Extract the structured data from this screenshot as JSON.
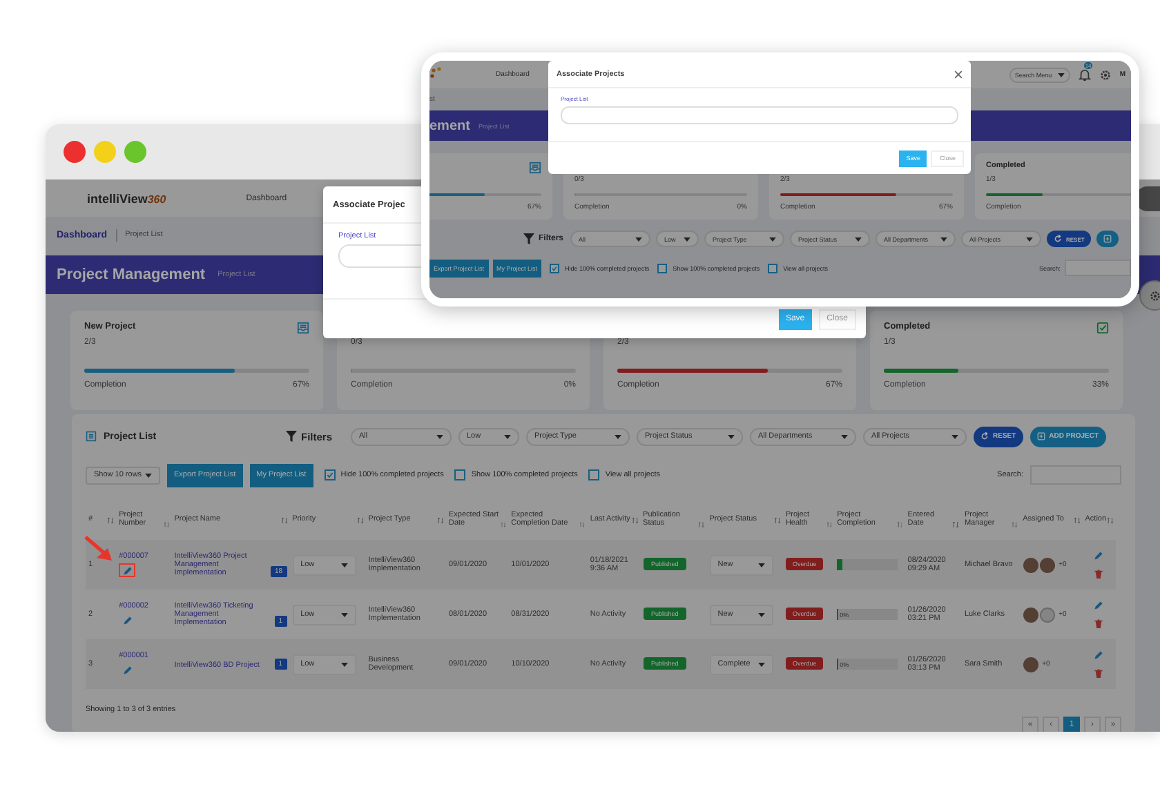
{
  "window_controls": [
    {
      "color": "#ec2f2f"
    },
    {
      "color": "#f3d11a"
    },
    {
      "color": "#69c52b"
    }
  ],
  "app": {
    "logo": {
      "text": "intelliView",
      "suffix": "360"
    },
    "nav": [
      "Dashboard"
    ],
    "breadcrumb": [
      "Dashboard",
      "Project List"
    ],
    "banner": {
      "title": "Project Management",
      "subtitle": "Project List"
    },
    "cards": [
      {
        "title": "New Project",
        "count": "2/3",
        "level": 0.67,
        "color": "#195f82",
        "label": "Completion",
        "percent": "67%"
      },
      {
        "count": "0/3",
        "level": 0,
        "label": "Completion",
        "percent": "0%"
      },
      {
        "count": "2/3",
        "level": 0.67,
        "color": "#821d1d",
        "label": "Completion",
        "percent": "67%"
      },
      {
        "title": "Completed",
        "count": "1/3",
        "level": 0.33,
        "color": "#14652c",
        "label": "Completion",
        "percent": "33%"
      }
    ],
    "list_title": "Project List",
    "filters": {
      "label": "Filters",
      "selects": [
        "All",
        "Low",
        "Project Type",
        "Project Status",
        "All Departments",
        "All Projects"
      ],
      "buttons": [
        {
          "kind": "reset",
          "label": "RESET"
        },
        {
          "kind": "add",
          "label": "ADD PROJECT"
        }
      ]
    },
    "rows_select": "Show 10 rows",
    "action_buttons": [
      "Export Project List",
      "My Project List"
    ],
    "checkboxes": [
      {
        "label": "Hide 100% completed projects",
        "checked": true
      },
      {
        "label": "Show 100% completed projects",
        "checked": false
      },
      {
        "label": "View all projects",
        "checked": false
      }
    ],
    "search_label": "Search:",
    "table": {
      "columns": [
        "#",
        "Project Number",
        "Project Name",
        "Priority",
        "Project Type",
        "Expected Start Date",
        "Expected Completion Date",
        "Last Activity",
        "Publication Status",
        "Project Status",
        "Project Health",
        "Project Completion",
        "Entered Date",
        "Project Manager",
        "Assigned To",
        "Action"
      ],
      "rows": [
        {
          "index": "1",
          "number": "#000007",
          "highlighted": true,
          "name": "IntelliView360 Project Management Implementation",
          "badge": "18",
          "priority": "Low",
          "type": "IntelliView360 Implementation",
          "start": "09/01/2020",
          "end": "10/01/2020",
          "last_activity": "01/18/2021 9:36 AM",
          "publication": "Published",
          "status": "New",
          "health": "Overdue",
          "level": 0.08,
          "entered": "08/24/2020 09:29 AM",
          "manager": "Michael Bravo",
          "avatars": [
            {
              "kind": "photo"
            },
            {
              "kind": "photo"
            }
          ],
          "more": "+0"
        },
        {
          "index": "2",
          "number": "#000002",
          "highlighted": false,
          "name": "IntelliView360 Ticketing Management Implementation",
          "badge": "1",
          "priority": "Low",
          "type": "IntelliView360 Implementation",
          "start": "08/01/2020",
          "end": "08/31/2020",
          "last_activity": "No Activity",
          "publication": "Published",
          "status": "New",
          "health": "Overdue",
          "level": 0,
          "completion_text": "0%",
          "entered": "01/26/2020 03:21 PM",
          "manager": "Luke Clarks",
          "avatars": [
            {
              "kind": "photo"
            },
            {
              "kind": "silhouette"
            }
          ],
          "more": "+0"
        },
        {
          "index": "3",
          "number": "#000001",
          "highlighted": false,
          "name": "IntelliView360 BD Project",
          "badge": "1",
          "priority": "Low",
          "type": "Business Development",
          "start": "09/01/2020",
          "end": "10/10/2020",
          "last_activity": "No Activity",
          "publication": "Published",
          "status": "Complete",
          "health": "Overdue",
          "level": 0,
          "completion_text": "0%",
          "entered": "01/26/2020 03:13 PM",
          "manager": "Sara Smith",
          "avatars": [
            {
              "kind": "photo"
            }
          ],
          "more": "+0"
        }
      ]
    },
    "footer": "Showing 1 to 3 of 3 entries",
    "pagination": [
      {
        "label": "«",
        "selected": false
      },
      {
        "label": "‹",
        "selected": false
      },
      {
        "label": "1",
        "selected": true
      },
      {
        "label": "›",
        "selected": false
      },
      {
        "label": "»",
        "selected": false
      }
    ]
  },
  "modal": {
    "title": "Associate Projec",
    "field_label": "Project List",
    "buttons": [
      {
        "kind": "primary",
        "label": "Save"
      },
      {
        "kind": "secondary",
        "label": "Close"
      }
    ]
  },
  "inset": {
    "nav": [
      "Dashboard"
    ],
    "search": "Search Menu",
    "badge": "14",
    "user": "M",
    "breadcrumb": "st",
    "banner": {
      "title": "ement",
      "subtitle": "Project List"
    },
    "cards": [
      {
        "level": 0.67,
        "color": "#195f82",
        "percent": "67%"
      },
      {
        "count": "0/3",
        "level": 0,
        "label": "Completion",
        "percent": "0%"
      },
      {
        "count": "2/3",
        "level": 0.67,
        "color": "#821d1d",
        "label": "Completion",
        "percent": "67%"
      },
      {
        "title": "Completed",
        "count": "1/3",
        "level": 0.33,
        "color": "#14652c",
        "label": "Completion"
      }
    ],
    "filters": {
      "label": "Filters",
      "selects": [
        "All",
        "Low",
        "Project Type",
        "Project Status",
        "All Departments",
        "All Projects"
      ],
      "buttons": [
        {
          "kind": "reset",
          "label": "RESET"
        },
        {
          "kind": "add"
        }
      ]
    },
    "action_buttons": [
      "Export Project List",
      "My Project List"
    ],
    "checkboxes": [
      {
        "label": "Hide 100% completed projects",
        "checked": true
      },
      {
        "label": "Show 100% completed projects",
        "checked": false
      },
      {
        "label": "View all projects",
        "checked": false
      }
    ],
    "search_label": "Search:",
    "modal": {
      "title": "Associate Projects",
      "field_label": "Project List",
      "buttons": [
        {
          "kind": "primary",
          "label": "Save"
        },
        {
          "kind": "secondary",
          "label": "Close"
        }
      ]
    }
  }
}
